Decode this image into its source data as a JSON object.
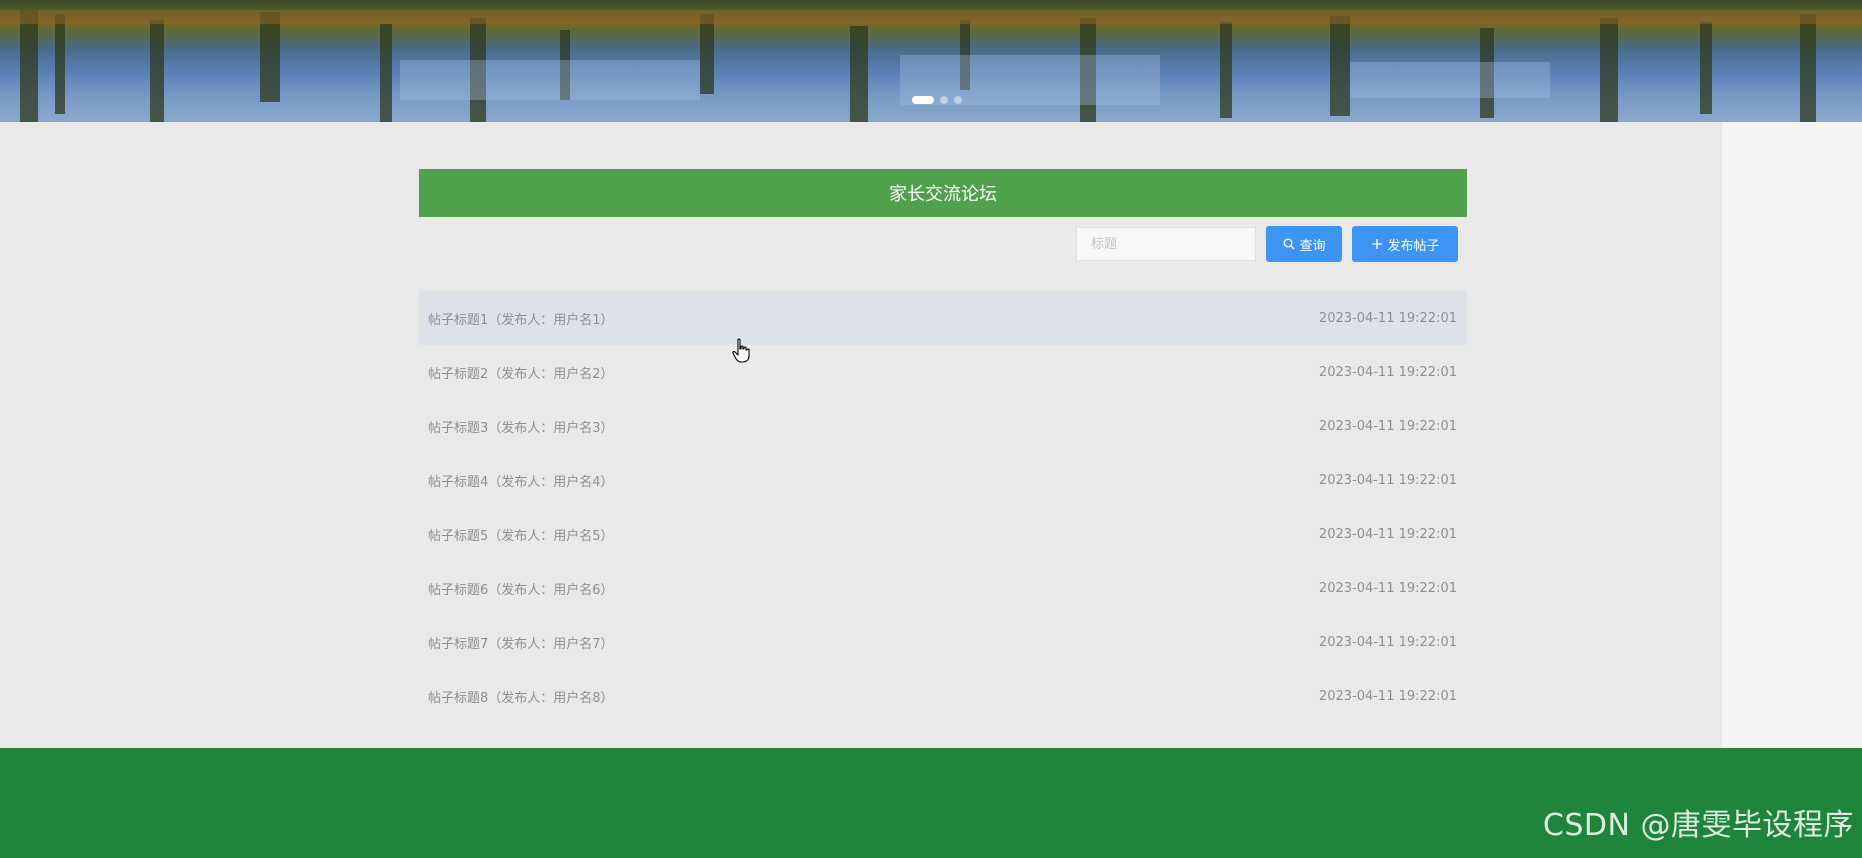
{
  "forum": {
    "title": "家长交流论坛",
    "search": {
      "placeholder": "标题",
      "value": ""
    },
    "query_button": {
      "label": "查询",
      "icon": "search-icon"
    },
    "publish_button": {
      "label": "发布帖子",
      "icon": "plus-icon"
    },
    "posts": [
      {
        "title": "帖子标题1（发布人：用户名1）",
        "time": "2023-04-11 19:22:01"
      },
      {
        "title": "帖子标题2（发布人：用户名2）",
        "time": "2023-04-11 19:22:01"
      },
      {
        "title": "帖子标题3（发布人：用户名3）",
        "time": "2023-04-11 19:22:01"
      },
      {
        "title": "帖子标题4（发布人：用户名4）",
        "time": "2023-04-11 19:22:01"
      },
      {
        "title": "帖子标题5（发布人：用户名5）",
        "time": "2023-04-11 19:22:01"
      },
      {
        "title": "帖子标题6（发布人：用户名6）",
        "time": "2023-04-11 19:22:01"
      },
      {
        "title": "帖子标题7（发布人：用户名7）",
        "time": "2023-04-11 19:22:01"
      },
      {
        "title": "帖子标题8（发布人：用户名8）",
        "time": "2023-04-11 19:22:01"
      }
    ]
  },
  "carousel": {
    "slide_count": 3,
    "active_index": 0
  },
  "watermark": "CSDN @唐雯毕设程序",
  "colors": {
    "header_green": "#51a04b",
    "footer_green": "#1f853d",
    "button_blue": "#3d95f3",
    "row_hover": "#dde1e8"
  }
}
